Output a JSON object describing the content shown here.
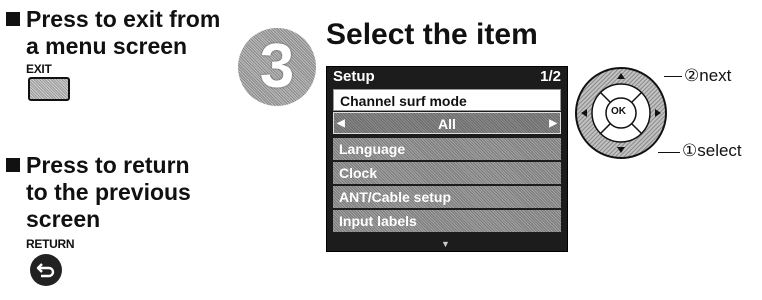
{
  "left": {
    "exit_heading_line1": "Press to exit from",
    "exit_heading_line2": "a menu screen",
    "exit_button_label": "EXIT",
    "return_heading_line1": "Press to return",
    "return_heading_line2": "to the previous",
    "return_heading_line3": "screen",
    "return_button_label": "RETURN"
  },
  "step": {
    "number": "3",
    "title": "Select the item"
  },
  "menu": {
    "title": "Setup",
    "page": "1/2",
    "selected_item": "Channel surf mode",
    "selected_value": "All",
    "items": [
      "Language",
      "Clock",
      "ANT/Cable setup",
      "Input labels"
    ]
  },
  "remote": {
    "center_label": "OK",
    "next_label": "②next",
    "select_label": "①select"
  }
}
